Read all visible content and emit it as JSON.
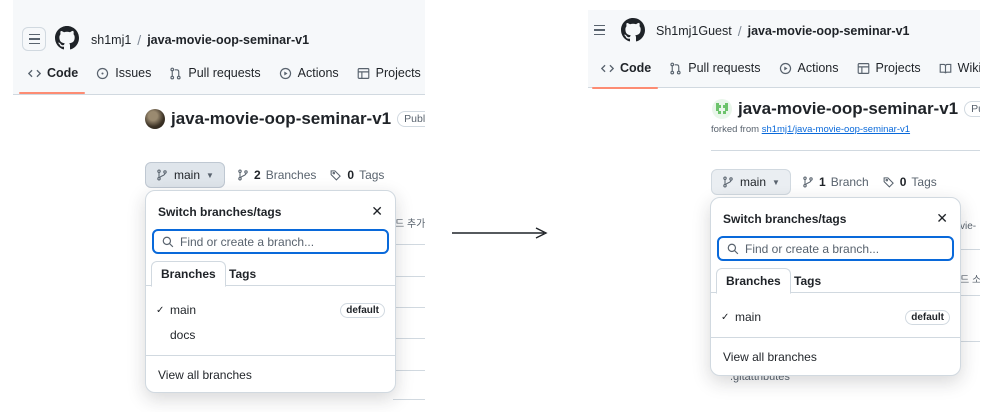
{
  "before": {
    "owner": "sh1mj1",
    "separator": "/",
    "repo": "java-movie-oop-seminar-v1",
    "tabs": [
      {
        "label": "Code",
        "icon": "code-icon"
      },
      {
        "label": "Issues",
        "icon": "issue-icon"
      },
      {
        "label": "Pull requests",
        "icon": "pull-request-icon"
      },
      {
        "label": "Actions",
        "icon": "play-icon"
      },
      {
        "label": "Projects",
        "icon": "table-icon"
      }
    ],
    "title": "java-movie-oop-seminar-v1",
    "visibility": "Public",
    "branch": "main",
    "branches_count": "2",
    "branches_label": "Branches",
    "tags_count": "0",
    "tags_label": "Tags",
    "bg_fragment": "드 추가",
    "popover": {
      "title": "Switch branches/tags",
      "search_placeholder": "Find or create a branch...",
      "tab_branches": "Branches",
      "tab_tags": "Tags",
      "items": [
        {
          "label": "main",
          "check": "✓",
          "badge": "default"
        },
        {
          "label": "docs",
          "check": "",
          "badge": ""
        }
      ],
      "footer": "View all branches"
    }
  },
  "after": {
    "owner": "Sh1mj1Guest",
    "separator": "/",
    "repo": "java-movie-oop-seminar-v1",
    "tabs": [
      {
        "label": "Code",
        "icon": "code-icon"
      },
      {
        "label": "Pull requests",
        "icon": "pull-request-icon"
      },
      {
        "label": "Actions",
        "icon": "play-icon"
      },
      {
        "label": "Projects",
        "icon": "table-icon"
      },
      {
        "label": "Wiki",
        "icon": "book-icon"
      }
    ],
    "title": "java-movie-oop-seminar-v1",
    "visibility": "Public",
    "forked_prefix": "forked from",
    "forked_link": "sh1mj1/java-movie-oop-seminar-v1",
    "branch": "main",
    "branches_count": "1",
    "branches_label": "Branch",
    "tags_count": "0",
    "tags_label": "Tags",
    "bg_fragment_1": "vie-",
    "bg_fragment_2": "드 소",
    "bg_fragment_3": ".gitattributes",
    "popover": {
      "title": "Switch branches/tags",
      "search_placeholder": "Find or create a branch...",
      "tab_branches": "Branches",
      "tab_tags": "Tags",
      "items": [
        {
          "label": "main",
          "check": "✓",
          "badge": "default"
        }
      ],
      "footer": "View all branches"
    }
  },
  "colors": {
    "accent_underline": "#fd8c73",
    "focus_blue": "#0969da",
    "header_bg": "#f6f8fa"
  }
}
